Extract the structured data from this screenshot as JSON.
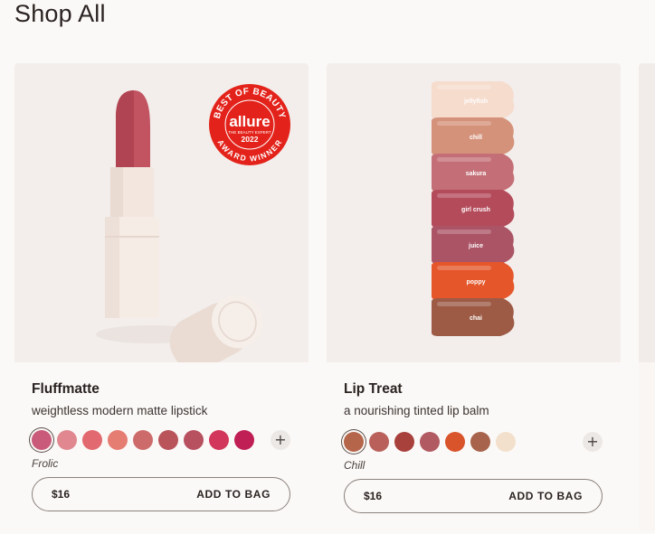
{
  "page": {
    "title": "Shop All"
  },
  "badge": {
    "brand": "allure",
    "top_text": "BEST OF BEAUTY",
    "sub_text": "THE BEAUTY EXPERT",
    "year": "2022",
    "bottom_text": "AWARD WINNER",
    "color": "#e3231b"
  },
  "products": [
    {
      "name": "Fluffmatte",
      "description": "weightless modern matte lipstick",
      "selected_shade": "Frolic",
      "price": "$16",
      "cta": "ADD TO BAG",
      "more_shades_icon": "plus-icon",
      "swatch_colors": [
        "#c95a7a",
        "#e0878f",
        "#e2696f",
        "#e67d73",
        "#cd6b6b",
        "#b9545b",
        "#b7505f",
        "#d2365a",
        "#bf1f55"
      ]
    },
    {
      "name": "Lip Treat",
      "description": "a nourishing tinted lip balm",
      "selected_shade": "Chill",
      "price": "$16",
      "cta": "ADD TO BAG",
      "more_shades_icon": "plus-icon",
      "swatch_colors": [
        "#b5654a",
        "#b9605a",
        "#a8403c",
        "#b15a62",
        "#d9532b",
        "#a8634c",
        "#f3e0cc"
      ],
      "shade_labels": [
        "jellyfish",
        "chill",
        "sakura",
        "girl crush",
        "juice",
        "poppy",
        "chai"
      ],
      "shade_colors": [
        "#f5dccd",
        "#d5927a",
        "#c46f77",
        "#b44b5b",
        "#ab5466",
        "#e5562a",
        "#9d5a45"
      ]
    }
  ]
}
